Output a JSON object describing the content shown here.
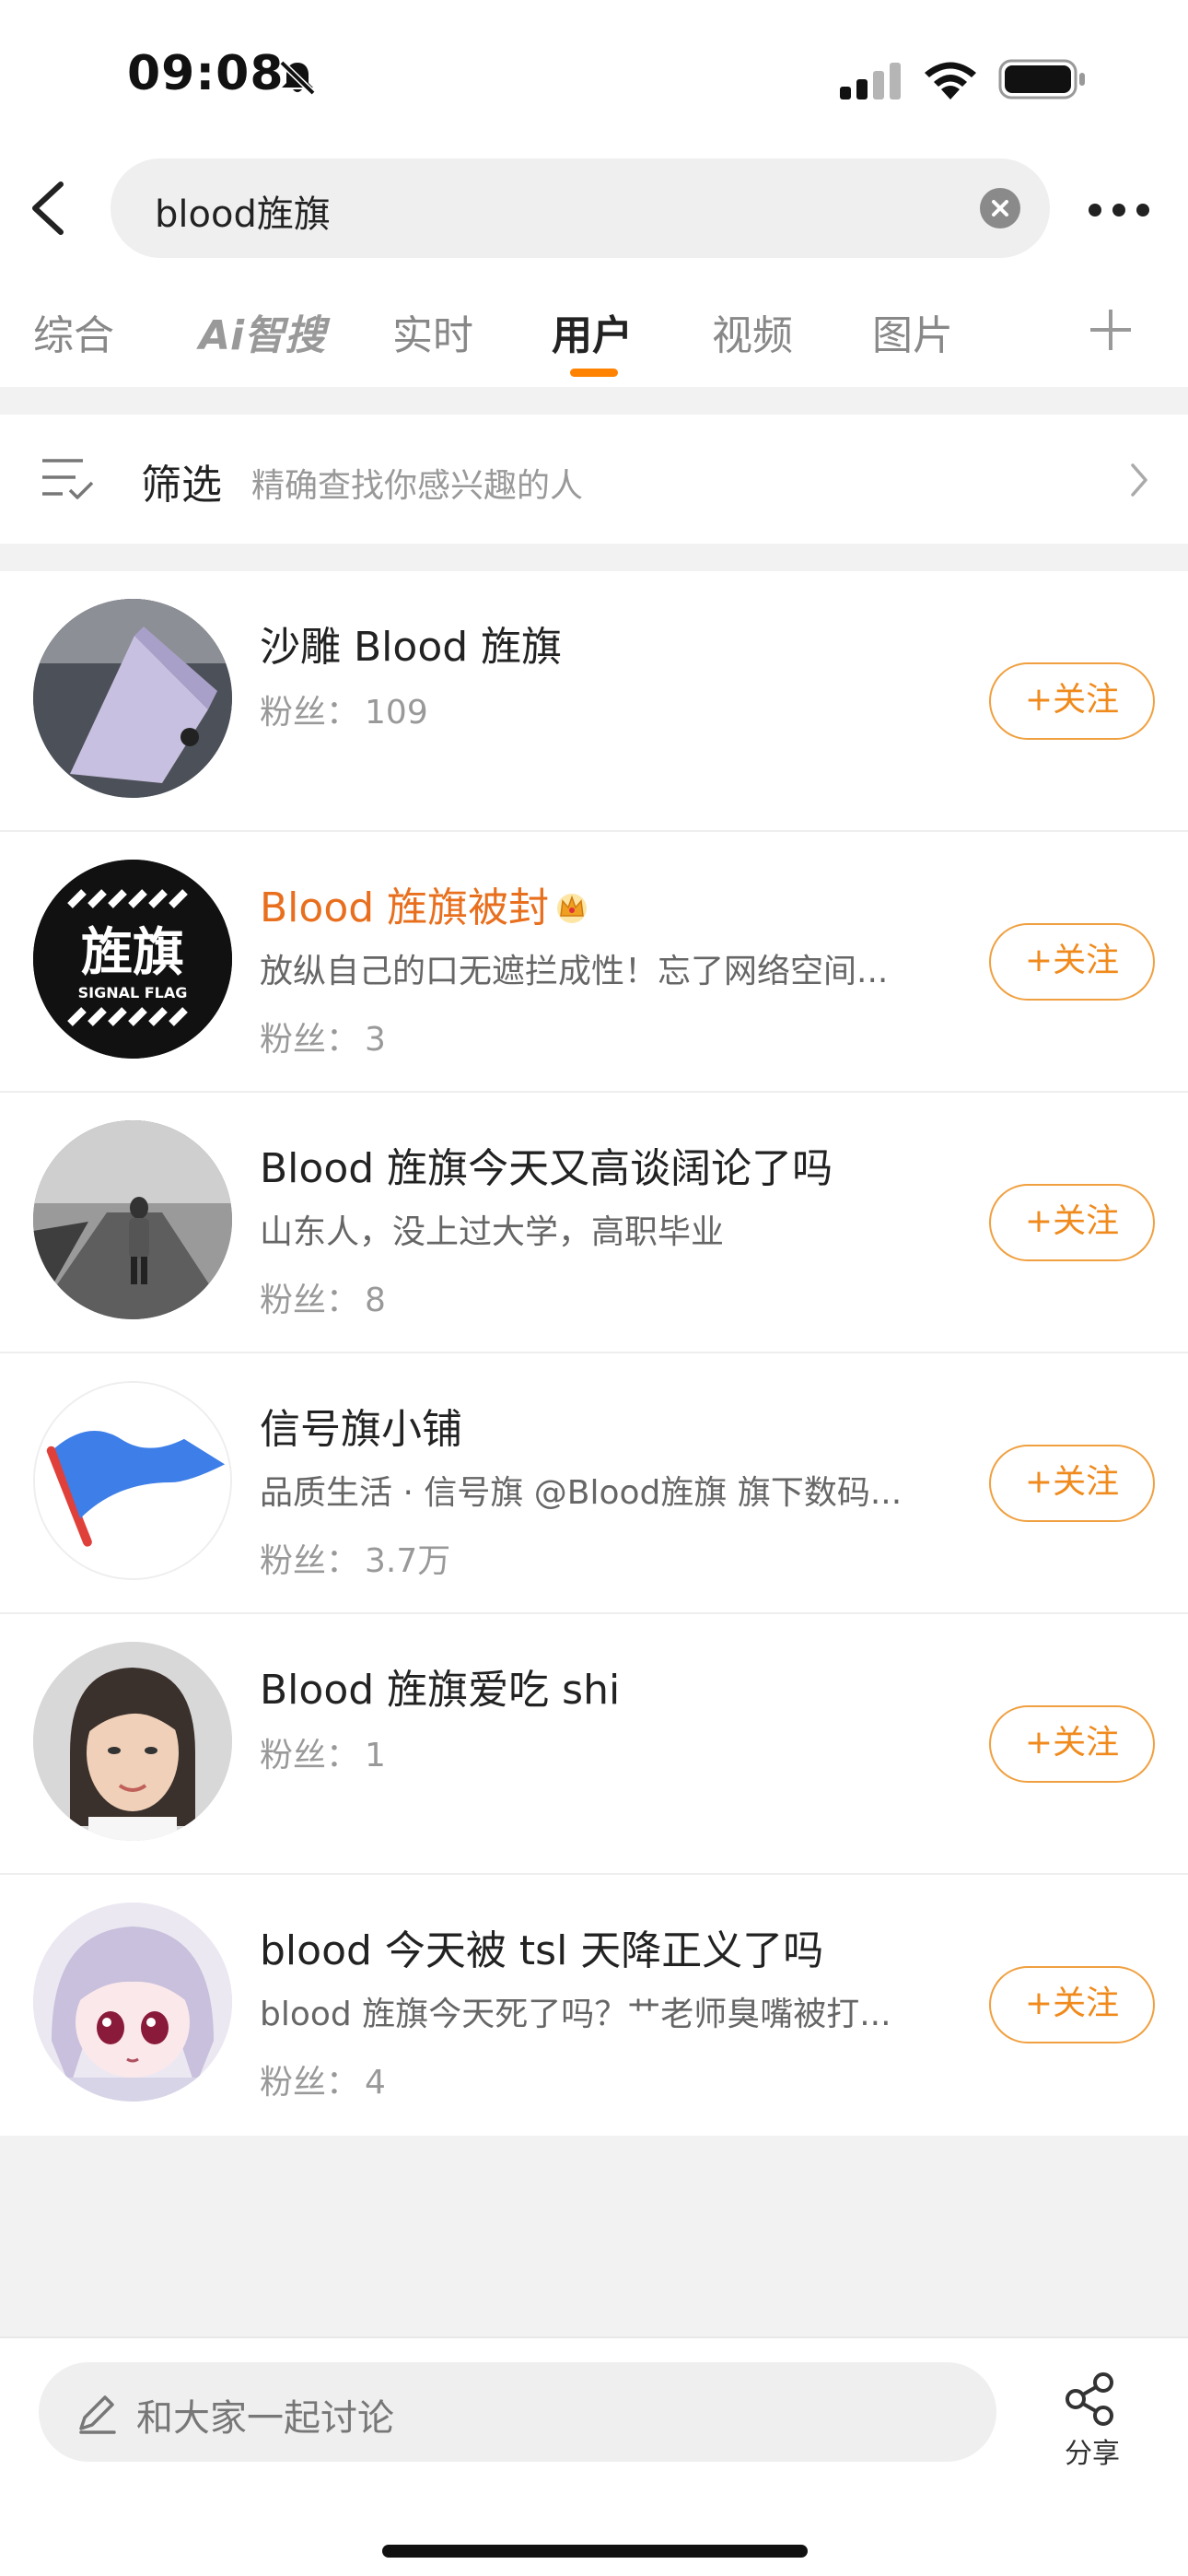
{
  "status_bar": {
    "time": "09:08"
  },
  "search": {
    "query": "blood旌旗"
  },
  "tabs": [
    {
      "label": "综合"
    },
    {
      "label": "Ai智搜"
    },
    {
      "label": "实时"
    },
    {
      "label": "用户",
      "active": true
    },
    {
      "label": "视频"
    },
    {
      "label": "图片"
    }
  ],
  "filter": {
    "title": "筛选",
    "subtitle": "精确查找你感兴趣的人"
  },
  "users": [
    {
      "name": "沙雕 Blood 旌旗",
      "description": "",
      "fans_label": "粉丝：",
      "fans": "109",
      "follow_label": "+关注"
    },
    {
      "name": "Blood 旌旗被封",
      "description": "放纵自己的口无遮拦成性！忘了网络空间...",
      "fans_label": "粉丝：",
      "fans": "3",
      "follow_label": "+关注"
    },
    {
      "name": "Blood 旌旗今天又高谈阔论了吗",
      "description": "山东人，没上过大学，高职毕业",
      "fans_label": "粉丝：",
      "fans": "8",
      "follow_label": "+关注"
    },
    {
      "name": "信号旗小铺",
      "description": "品质生活 · 信号旗 @Blood旌旗 旗下数码...",
      "fans_label": "粉丝：",
      "fans": "3.7万",
      "follow_label": "+关注"
    },
    {
      "name": "Blood 旌旗爱吃 shi",
      "description": "",
      "fans_label": "粉丝：",
      "fans": "1",
      "follow_label": "+关注"
    },
    {
      "name": "blood 今天被 tsl 天降正义了吗",
      "description": "blood 旌旗今天死了吗？艹老师臭嘴被打...",
      "fans_label": "粉丝：",
      "fans": "4",
      "follow_label": "+关注"
    }
  ],
  "avatar_logo": {
    "main": "旌旗",
    "sub": "SIGNAL FLAG"
  },
  "bottom_bar": {
    "comment_placeholder": "和大家一起讨论",
    "share_label": "分享"
  },
  "colors": {
    "accent": "#ff8200",
    "highlight_name": "#e86f1e",
    "follow_border": "#f0a040"
  }
}
